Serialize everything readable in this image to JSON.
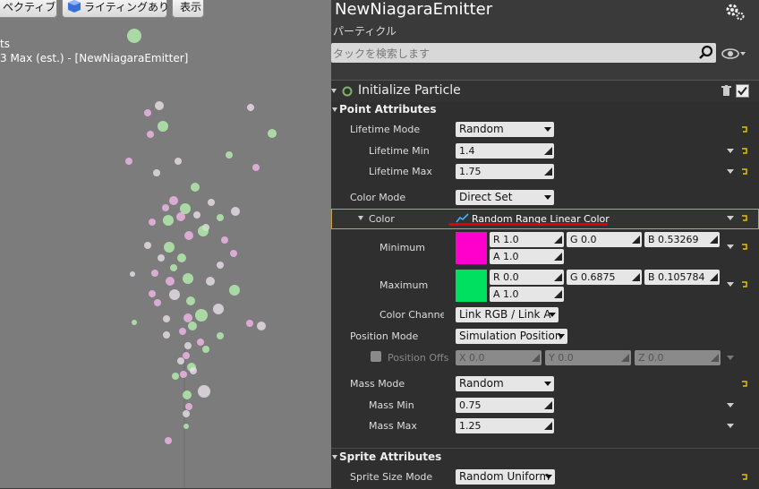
{
  "viewport": {
    "perspective_btn": "ペクティブ",
    "lighting_btn": "ライティングあり",
    "show_btn": "表示",
    "stat_line1": "ts",
    "stat_line2": "3 Max (est.) - [NewNiagaraEmitter]"
  },
  "emitter": {
    "title": "NewNiagaraEmitter",
    "subtitle": "パーティクル",
    "search_placeholder": "タックを検索します"
  },
  "module": {
    "name": "Initialize Particle"
  },
  "point_attributes": {
    "header": "Point Attributes",
    "lifetime_mode_label": "Lifetime Mode",
    "lifetime_mode_value": "Random",
    "lifetime_min_label": "Lifetime Min",
    "lifetime_min_value": "1.4",
    "lifetime_max_label": "Lifetime Max",
    "lifetime_max_value": "1.75",
    "color_mode_label": "Color Mode",
    "color_mode_value": "Direct Set",
    "color_label": "Color",
    "color_value": "Random Range Linear Color",
    "minimum_label": "Minimum",
    "min_r": "R 1.0",
    "min_g": "G 0.0",
    "min_b": "B 0.53269",
    "min_a": "A 1.0",
    "min_swatch": "#ff00cc",
    "maximum_label": "Maximum",
    "max_r": "R 0.0",
    "max_g": "G 0.6875",
    "max_b": "B 0.105784",
    "max_a": "A 1.0",
    "max_swatch": "#00e060",
    "color_channel_label": "Color Channel M",
    "color_channel_value": "Link RGB / Link A",
    "position_mode_label": "Position Mode",
    "position_mode_value": "Simulation Position",
    "position_offset_label": "Position Offs",
    "pos_x": "X 0.0",
    "pos_y": "Y 0.0",
    "pos_z": "Z 0.0",
    "mass_mode_label": "Mass Mode",
    "mass_mode_value": "Random",
    "mass_min_label": "Mass Min",
    "mass_min_value": "0.75",
    "mass_max_label": "Mass Max",
    "mass_max_value": "1.25"
  },
  "sprite_attributes": {
    "header": "Sprite Attributes",
    "size_mode_label": "Sprite Size Mode",
    "size_mode_value": "Random Uniform"
  }
}
